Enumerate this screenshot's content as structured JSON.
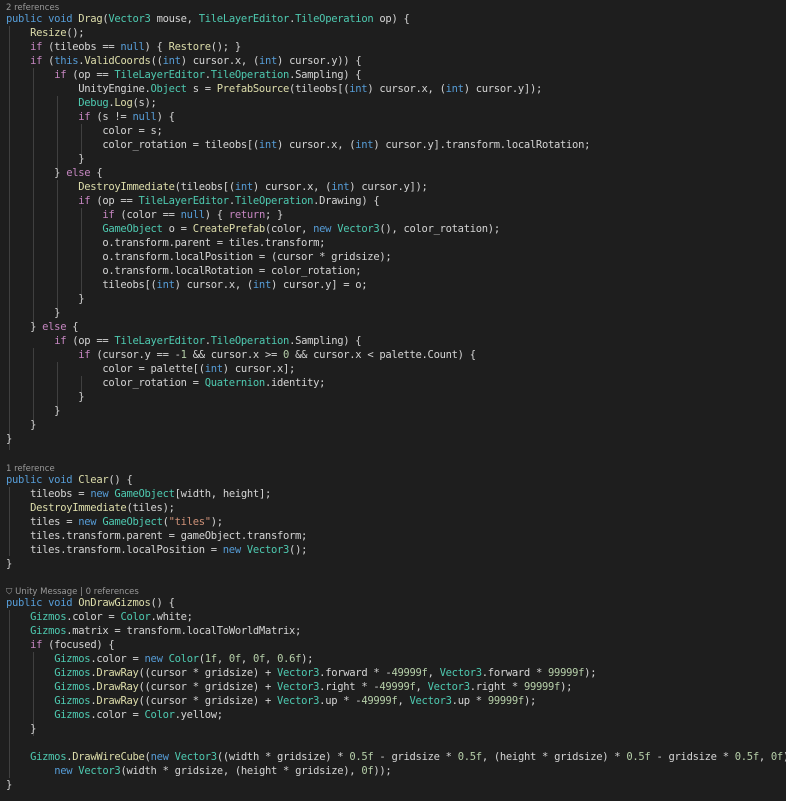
{
  "lenses": {
    "drag": "2 references",
    "clear": "1 reference",
    "ongizmos_icon": "⛉",
    "ongizmos": "Unity Message | 0 references"
  },
  "lines": [
    [
      [
        "public void ",
        "k"
      ],
      [
        "Drag",
        "f"
      ],
      [
        "(",
        "v"
      ],
      [
        "Vector3",
        "t"
      ],
      [
        " mouse, ",
        "v"
      ],
      [
        "TileLayerEditor",
        "t"
      ],
      [
        ".",
        "v"
      ],
      [
        "TileOperation",
        "t"
      ],
      [
        " op) {",
        "v"
      ]
    ],
    [
      [
        "    ",
        ""
      ],
      [
        "Resize",
        "f"
      ],
      [
        "();",
        "v"
      ]
    ],
    [
      [
        "    ",
        ""
      ],
      [
        "if",
        "c"
      ],
      [
        " (tileobs == ",
        "v"
      ],
      [
        "null",
        "k"
      ],
      [
        ") { ",
        "v"
      ],
      [
        "Restore",
        "f"
      ],
      [
        "(); }",
        "v"
      ]
    ],
    [
      [
        "    ",
        ""
      ],
      [
        "if",
        "c"
      ],
      [
        " (",
        "v"
      ],
      [
        "this",
        "k"
      ],
      [
        ".",
        "v"
      ],
      [
        "ValidCoords",
        "f"
      ],
      [
        "((",
        "v"
      ],
      [
        "int",
        "k"
      ],
      [
        ") cursor.x, (",
        "v"
      ],
      [
        "int",
        "k"
      ],
      [
        ") cursor.y)) {",
        "v"
      ]
    ],
    [
      [
        "        ",
        ""
      ],
      [
        "if",
        "c"
      ],
      [
        " (op == ",
        "v"
      ],
      [
        "TileLayerEditor",
        "t"
      ],
      [
        ".",
        "v"
      ],
      [
        "TileOperation",
        "t"
      ],
      [
        ".Sampling) {",
        "v"
      ]
    ],
    [
      [
        "            UnityEngine.",
        ""
      ],
      [
        "Object",
        "t"
      ],
      [
        " s = ",
        "v"
      ],
      [
        "PrefabSource",
        "f"
      ],
      [
        "(tileobs[(",
        "v"
      ],
      [
        "int",
        "k"
      ],
      [
        ") cursor.x, (",
        "v"
      ],
      [
        "int",
        "k"
      ],
      [
        ") cursor.y]);",
        "v"
      ]
    ],
    [
      [
        "            ",
        ""
      ],
      [
        "Debug",
        "t"
      ],
      [
        ".",
        "v"
      ],
      [
        "Log",
        "f"
      ],
      [
        "(s);",
        "v"
      ]
    ],
    [
      [
        "            ",
        ""
      ],
      [
        "if",
        "c"
      ],
      [
        " (s != ",
        "v"
      ],
      [
        "null",
        "k"
      ],
      [
        ") {",
        "v"
      ]
    ],
    [
      [
        "                color = s;",
        ""
      ]
    ],
    [
      [
        "                color_rotation = tileobs[(",
        ""
      ],
      [
        "int",
        "k"
      ],
      [
        ") cursor.x, (",
        "v"
      ],
      [
        "int",
        "k"
      ],
      [
        ") cursor.y].transform.localRotation;",
        "v"
      ]
    ],
    [
      [
        "            }",
        ""
      ]
    ],
    [
      [
        "        } ",
        ""
      ],
      [
        "else",
        "c"
      ],
      [
        " {",
        "v"
      ]
    ],
    [
      [
        "            ",
        ""
      ],
      [
        "DestroyImmediate",
        "f"
      ],
      [
        "(tileobs[(",
        "v"
      ],
      [
        "int",
        "k"
      ],
      [
        ") cursor.x, (",
        "v"
      ],
      [
        "int",
        "k"
      ],
      [
        ") cursor.y]);",
        "v"
      ]
    ],
    [
      [
        "            ",
        ""
      ],
      [
        "if",
        "c"
      ],
      [
        " (op == ",
        "v"
      ],
      [
        "TileLayerEditor",
        "t"
      ],
      [
        ".",
        "v"
      ],
      [
        "TileOperation",
        "t"
      ],
      [
        ".Drawing) {",
        "v"
      ]
    ],
    [
      [
        "                ",
        ""
      ],
      [
        "if",
        "c"
      ],
      [
        " (color == ",
        "v"
      ],
      [
        "null",
        "k"
      ],
      [
        ") { ",
        "v"
      ],
      [
        "return",
        "c"
      ],
      [
        "; }",
        "v"
      ]
    ],
    [
      [
        "                ",
        ""
      ],
      [
        "GameObject",
        "t"
      ],
      [
        " o = ",
        "v"
      ],
      [
        "CreatePrefab",
        "f"
      ],
      [
        "(color, ",
        "v"
      ],
      [
        "new",
        "k"
      ],
      [
        " ",
        "v"
      ],
      [
        "Vector3",
        "t"
      ],
      [
        "(), color_rotation);",
        "v"
      ]
    ],
    [
      [
        "                o.transform.parent = tiles.transform;",
        ""
      ]
    ],
    [
      [
        "                o.transform.localPosition = (cursor * gridsize);",
        ""
      ]
    ],
    [
      [
        "                o.transform.localRotation = color_rotation;",
        ""
      ]
    ],
    [
      [
        "                tileobs[(",
        ""
      ],
      [
        "int",
        "k"
      ],
      [
        ") cursor.x, (",
        "v"
      ],
      [
        "int",
        "k"
      ],
      [
        ") cursor.y] = o;",
        "v"
      ]
    ],
    [
      [
        "            }",
        ""
      ]
    ],
    [
      [
        "        }",
        ""
      ]
    ],
    [
      [
        "    } ",
        ""
      ],
      [
        "else",
        "c"
      ],
      [
        " {",
        "v"
      ]
    ],
    [
      [
        "        ",
        ""
      ],
      [
        "if",
        "c"
      ],
      [
        " (op == ",
        "v"
      ],
      [
        "TileLayerEditor",
        "t"
      ],
      [
        ".",
        "v"
      ],
      [
        "TileOperation",
        "t"
      ],
      [
        ".Sampling) {",
        "v"
      ]
    ],
    [
      [
        "            ",
        ""
      ],
      [
        "if",
        "c"
      ],
      [
        " (cursor.y == -",
        "v"
      ],
      [
        "1",
        "n"
      ],
      [
        " && cursor.x >= ",
        "v"
      ],
      [
        "0",
        "n"
      ],
      [
        " && cursor.x < palette.Count) {",
        "v"
      ]
    ],
    [
      [
        "                color = palette[(",
        ""
      ],
      [
        "int",
        "k"
      ],
      [
        ") cursor.x];",
        "v"
      ]
    ],
    [
      [
        "                color_rotation = ",
        ""
      ],
      [
        "Quaternion",
        "t"
      ],
      [
        ".identity;",
        "v"
      ]
    ],
    [
      [
        "            }",
        ""
      ]
    ],
    [
      [
        "        }",
        ""
      ]
    ],
    [
      [
        "    }",
        ""
      ]
    ],
    [
      [
        "}",
        ""
      ]
    ],
    [
      [
        "public void ",
        "k"
      ],
      [
        "Clear",
        "f"
      ],
      [
        "() {",
        "v"
      ]
    ],
    [
      [
        "    tileobs = ",
        ""
      ],
      [
        "new",
        "k"
      ],
      [
        " ",
        "v"
      ],
      [
        "GameObject",
        "t"
      ],
      [
        "[width, height];",
        "v"
      ]
    ],
    [
      [
        "    ",
        ""
      ],
      [
        "DestroyImmediate",
        "f"
      ],
      [
        "(tiles);",
        "v"
      ]
    ],
    [
      [
        "    tiles = ",
        ""
      ],
      [
        "new",
        "k"
      ],
      [
        " ",
        "v"
      ],
      [
        "GameObject",
        "t"
      ],
      [
        "(",
        "v"
      ],
      [
        "\"tiles\"",
        "s"
      ],
      [
        ");",
        "v"
      ]
    ],
    [
      [
        "    tiles.transform.parent = gameObject.transform;",
        ""
      ]
    ],
    [
      [
        "    tiles.transform.localPosition = ",
        ""
      ],
      [
        "new",
        "k"
      ],
      [
        " ",
        "v"
      ],
      [
        "Vector3",
        "t"
      ],
      [
        "();",
        "v"
      ]
    ],
    [
      [
        "}",
        ""
      ]
    ],
    [
      [
        "public void ",
        "k"
      ],
      [
        "OnDrawGizmos",
        "f"
      ],
      [
        "() {",
        "v"
      ]
    ],
    [
      [
        "    ",
        ""
      ],
      [
        "Gizmos",
        "t"
      ],
      [
        ".color = ",
        "v"
      ],
      [
        "Color",
        "t"
      ],
      [
        ".white;",
        "v"
      ]
    ],
    [
      [
        "    ",
        ""
      ],
      [
        "Gizmos",
        "t"
      ],
      [
        ".matrix = transform.localToWorldMatrix;",
        "v"
      ]
    ],
    [
      [
        "    ",
        ""
      ],
      [
        "if",
        "c"
      ],
      [
        " (focused) {",
        "v"
      ]
    ],
    [
      [
        "        ",
        ""
      ],
      [
        "Gizmos",
        "t"
      ],
      [
        ".color = ",
        "v"
      ],
      [
        "new",
        "k"
      ],
      [
        " ",
        "v"
      ],
      [
        "Color",
        "t"
      ],
      [
        "(",
        "v"
      ],
      [
        "1f",
        "n"
      ],
      [
        ", ",
        "v"
      ],
      [
        "0f",
        "n"
      ],
      [
        ", ",
        "v"
      ],
      [
        "0f",
        "n"
      ],
      [
        ", ",
        "v"
      ],
      [
        "0.6f",
        "n"
      ],
      [
        ");",
        "v"
      ]
    ],
    [
      [
        "        ",
        ""
      ],
      [
        "Gizmos",
        "t"
      ],
      [
        ".",
        "v"
      ],
      [
        "DrawRay",
        "f"
      ],
      [
        "((cursor * gridsize) + ",
        "v"
      ],
      [
        "Vector3",
        "t"
      ],
      [
        ".forward * -",
        "v"
      ],
      [
        "49999f",
        "n"
      ],
      [
        ", ",
        "v"
      ],
      [
        "Vector3",
        "t"
      ],
      [
        ".forward * ",
        "v"
      ],
      [
        "99999f",
        "n"
      ],
      [
        ");",
        "v"
      ]
    ],
    [
      [
        "        ",
        ""
      ],
      [
        "Gizmos",
        "t"
      ],
      [
        ".",
        "v"
      ],
      [
        "DrawRay",
        "f"
      ],
      [
        "((cursor * gridsize) + ",
        "v"
      ],
      [
        "Vector3",
        "t"
      ],
      [
        ".right * -",
        "v"
      ],
      [
        "49999f",
        "n"
      ],
      [
        ", ",
        "v"
      ],
      [
        "Vector3",
        "t"
      ],
      [
        ".right * ",
        "v"
      ],
      [
        "99999f",
        "n"
      ],
      [
        ");",
        "v"
      ]
    ],
    [
      [
        "        ",
        ""
      ],
      [
        "Gizmos",
        "t"
      ],
      [
        ".",
        "v"
      ],
      [
        "DrawRay",
        "f"
      ],
      [
        "((cursor * gridsize) + ",
        "v"
      ],
      [
        "Vector3",
        "t"
      ],
      [
        ".up * -",
        "v"
      ],
      [
        "49999f",
        "n"
      ],
      [
        ", ",
        "v"
      ],
      [
        "Vector3",
        "t"
      ],
      [
        ".up * ",
        "v"
      ],
      [
        "99999f",
        "n"
      ],
      [
        ");",
        "v"
      ]
    ],
    [
      [
        "        ",
        ""
      ],
      [
        "Gizmos",
        "t"
      ],
      [
        ".color = ",
        "v"
      ],
      [
        "Color",
        "t"
      ],
      [
        ".yellow;",
        "v"
      ]
    ],
    [
      [
        "    }",
        ""
      ]
    ],
    [
      [
        "",
        ""
      ]
    ],
    [
      [
        "    ",
        ""
      ],
      [
        "Gizmos",
        "t"
      ],
      [
        ".",
        "v"
      ],
      [
        "DrawWireCube",
        "f"
      ],
      [
        "(",
        "v"
      ],
      [
        "new",
        "k"
      ],
      [
        " ",
        "v"
      ],
      [
        "Vector3",
        "t"
      ],
      [
        "((width * gridsize) * ",
        "v"
      ],
      [
        "0.5f",
        "n"
      ],
      [
        " - gridsize * ",
        "v"
      ],
      [
        "0.5f",
        "n"
      ],
      [
        ", (height * gridsize) * ",
        "v"
      ],
      [
        "0.5f",
        "n"
      ],
      [
        " - gridsize * ",
        "v"
      ],
      [
        "0.5f",
        "n"
      ],
      [
        ", ",
        "v"
      ],
      [
        "0f",
        "n"
      ],
      [
        "),",
        "v"
      ]
    ],
    [
      [
        "        ",
        ""
      ],
      [
        "new",
        "k"
      ],
      [
        " ",
        "v"
      ],
      [
        "Vector3",
        "t"
      ],
      [
        "(width * gridsize, (height * gridsize), ",
        "v"
      ],
      [
        "0f",
        "n"
      ],
      [
        "));",
        "v"
      ]
    ],
    [
      [
        "}",
        ""
      ]
    ]
  ]
}
